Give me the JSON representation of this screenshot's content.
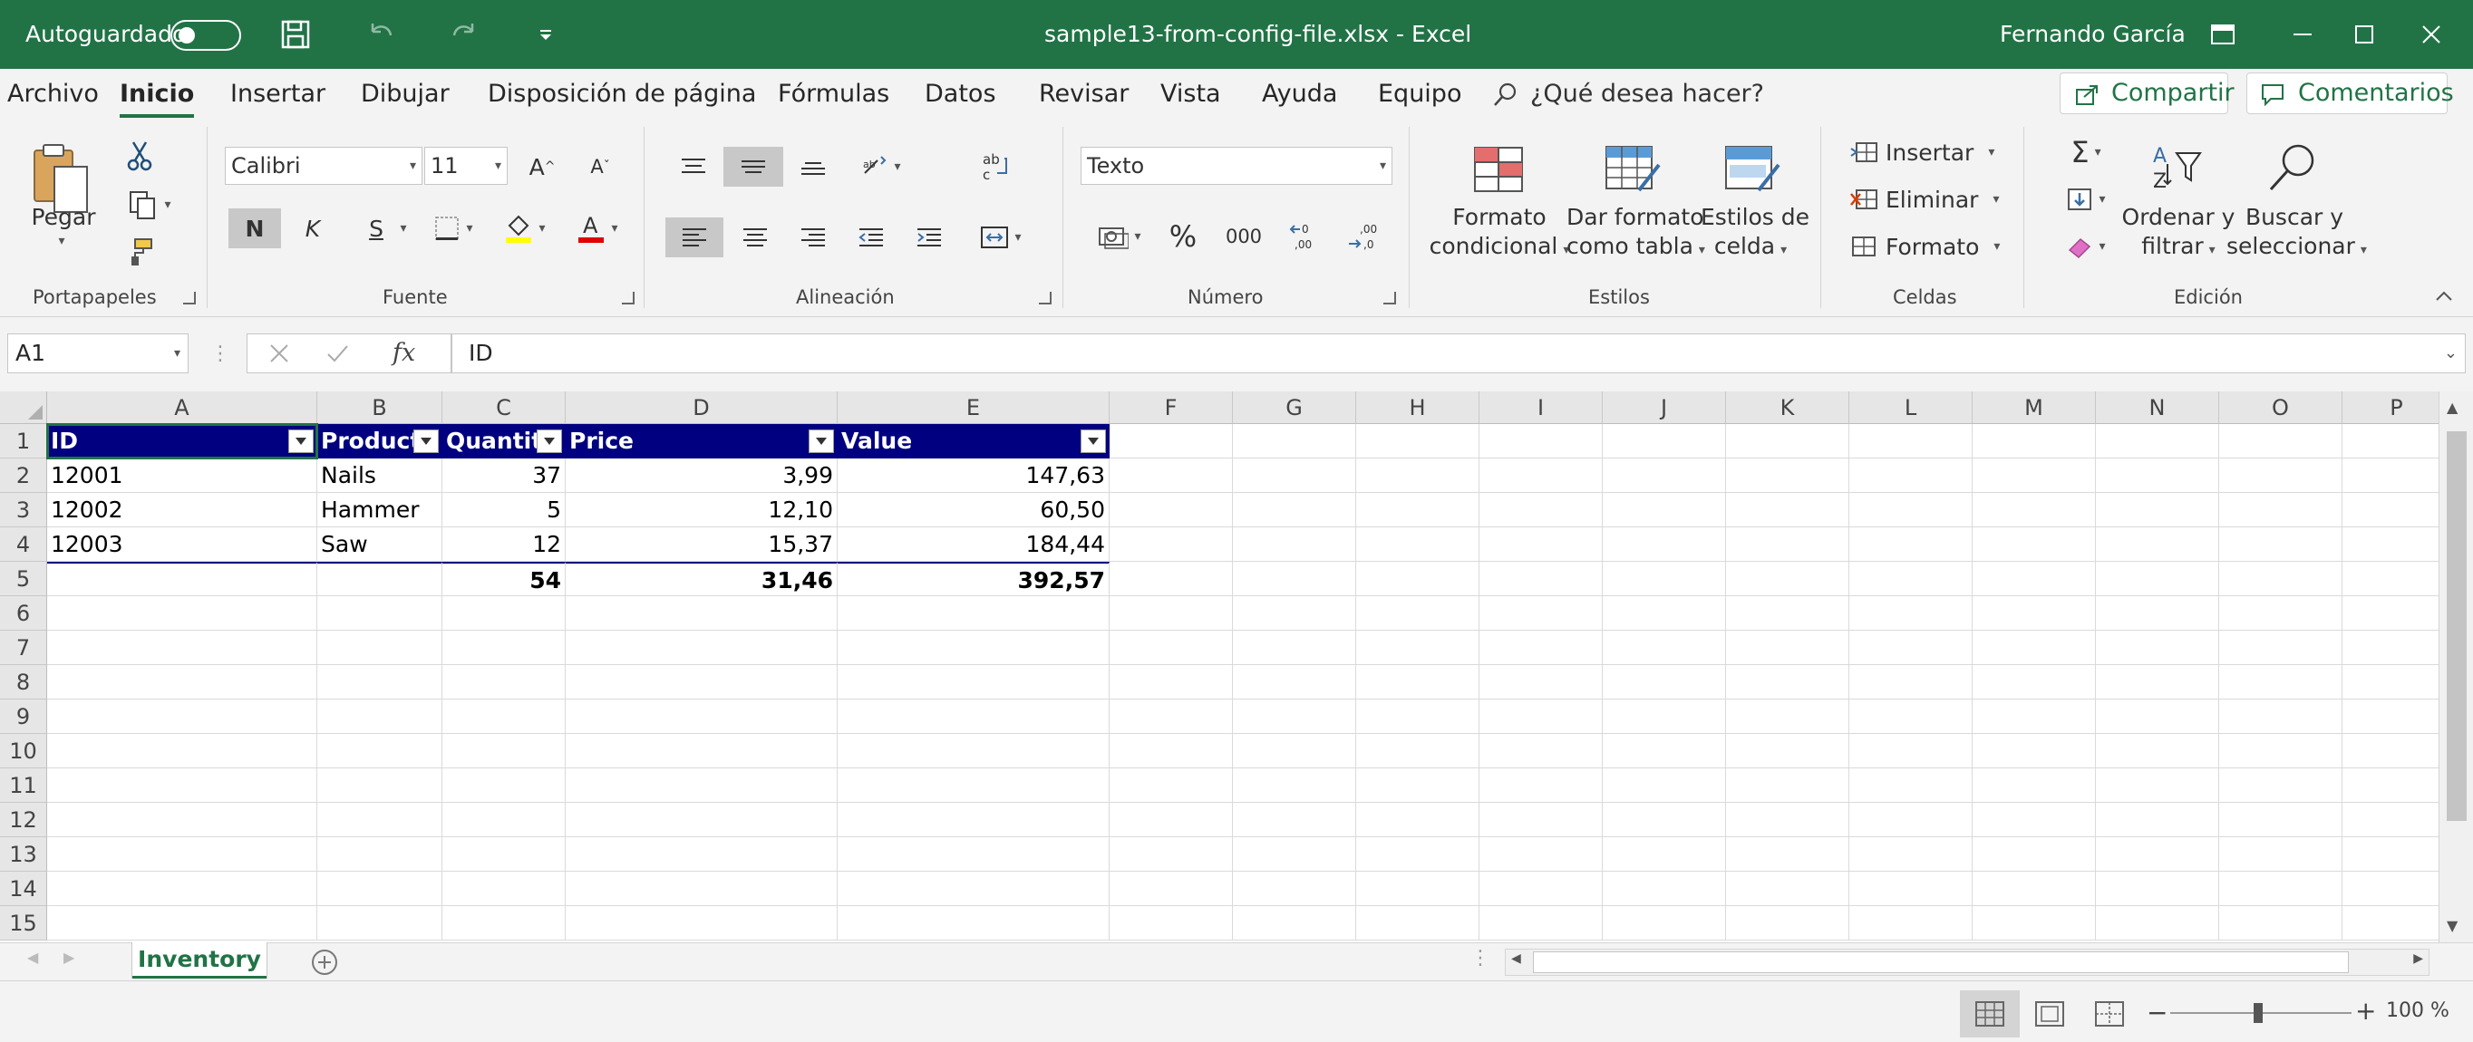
{
  "titlebar": {
    "autosave_label": "Autoguardado",
    "file_title": "sample13-from-config-file.xlsx  -  Excel",
    "user_name": "Fernando García"
  },
  "tabs": [
    "Archivo",
    "Inicio",
    "Insertar",
    "Dibujar",
    "Disposición de página",
    "Fórmulas",
    "Datos",
    "Revisar",
    "Vista",
    "Ayuda",
    "Equipo"
  ],
  "search_placeholder": "¿Qué desea hacer?",
  "share_label": "Compartir",
  "comments_label": "Comentarios",
  "ribbon": {
    "paste_label": "Pegar",
    "group_clipboard": "Portapapeles",
    "font_name": "Calibri",
    "font_size": "11",
    "bold": "N",
    "italic": "K",
    "underline": "S",
    "group_font": "Fuente",
    "group_alignment": "Alineación",
    "number_format": "Texto",
    "percent": "%",
    "thousands": "000",
    "group_number": "Número",
    "cond_format": [
      "Formato",
      "condicional"
    ],
    "format_table": [
      "Dar formato",
      "como tabla"
    ],
    "cell_styles": [
      "Estilos de",
      "celda"
    ],
    "group_styles": "Estilos",
    "insert": "Insertar",
    "delete": "Eliminar",
    "format": "Formato",
    "group_cells": "Celdas",
    "sort_filter": [
      "Ordenar y",
      "filtrar"
    ],
    "find_select": [
      "Buscar y",
      "seleccionar"
    ],
    "group_editing": "Edición"
  },
  "formula_bar": {
    "name_box": "A1",
    "fx": "fx",
    "value": "ID"
  },
  "columns": [
    "A",
    "B",
    "C",
    "D",
    "E",
    "F",
    "G",
    "H",
    "I",
    "J",
    "K",
    "L",
    "M",
    "N",
    "O",
    "P"
  ],
  "rows": [
    "1",
    "2",
    "3",
    "4",
    "5",
    "6",
    "7",
    "8",
    "9",
    "10",
    "11",
    "12",
    "13",
    "14",
    "15"
  ],
  "table": {
    "headers": [
      "ID",
      "Product",
      "Quantity",
      "Price",
      "Value"
    ],
    "rows": [
      [
        "12001",
        "Nails",
        "37",
        "3,99",
        "147,63"
      ],
      [
        "12002",
        "Hammer",
        "5",
        "12,10",
        "60,50"
      ],
      [
        "12003",
        "Saw",
        "12",
        "15,37",
        "184,44"
      ]
    ],
    "totals": [
      "",
      "",
      "54",
      "31,46",
      "392,57"
    ],
    "header_color": "#000080"
  },
  "sheet_tab": "Inventory",
  "zoom": "100 %",
  "accent_color": "#217346"
}
